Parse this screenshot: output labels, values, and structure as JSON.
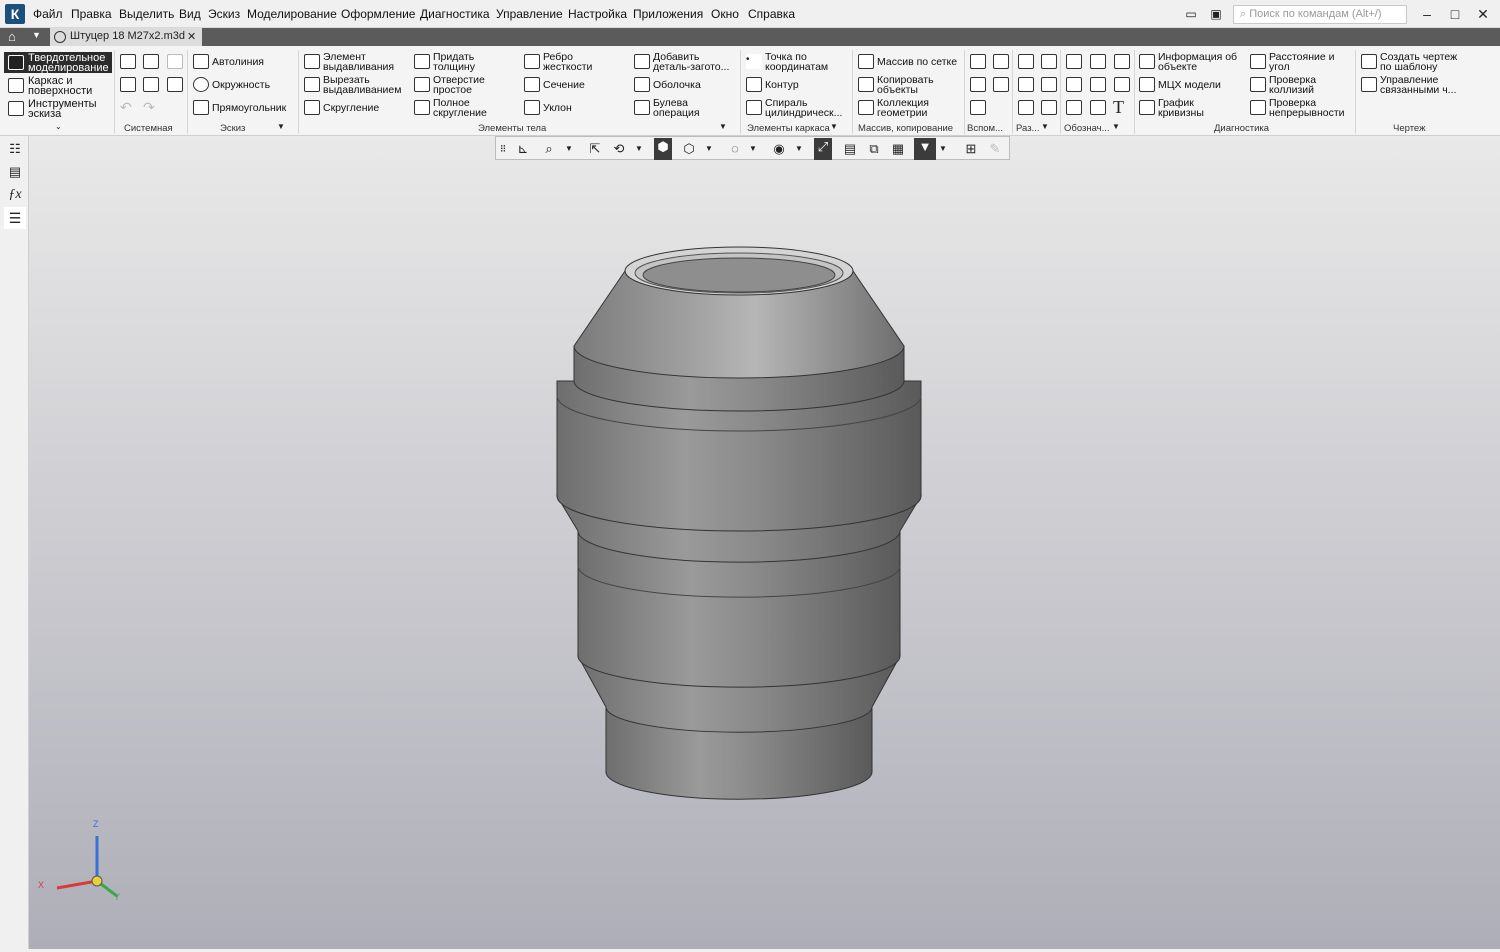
{
  "app": {
    "logo": "К",
    "icon": "kompas-logo-icon"
  },
  "menu": [
    "Файл",
    "Правка",
    "Выделить",
    "Вид",
    "Эскиз",
    "Моделирование",
    "Оформление",
    "Диагностика",
    "Управление",
    "Настройка",
    "Приложения",
    "Окно",
    "Справка"
  ],
  "search": {
    "placeholder": "Поиск по командам (Alt+/)"
  },
  "document_tab": {
    "title": "Штуцер 18 M27x2.m3d",
    "close": "✕"
  },
  "modes": [
    {
      "l1": "Твердотельное",
      "l2": "моделирование",
      "active": true
    },
    {
      "l1": "Каркас и",
      "l2": "поверхности",
      "active": false
    },
    {
      "l1": "Инструменты",
      "l2": "эскиза",
      "active": false
    }
  ],
  "ribbon": {
    "sketch": [
      "Автолиния",
      "Окружность",
      "Прямоугольник"
    ],
    "body": [
      {
        "l1": "Элемент",
        "l2": "выдавливания"
      },
      {
        "l1": "Вырезать",
        "l2": "выдавливанием"
      },
      {
        "l1": "Скругление",
        "l2": ""
      },
      {
        "l1": "Придать",
        "l2": "толщину"
      },
      {
        "l1": "Отверстие",
        "l2": "простое"
      },
      {
        "l1": "Полное",
        "l2": "скругление"
      },
      {
        "l1": "Ребро",
        "l2": "жесткости"
      },
      {
        "l1": "Сечение",
        "l2": ""
      },
      {
        "l1": "Уклон",
        "l2": ""
      },
      {
        "l1": "Добавить",
        "l2": "деталь-загото..."
      },
      {
        "l1": "Оболочка",
        "l2": ""
      },
      {
        "l1": "Булева",
        "l2": "операция"
      }
    ],
    "frame": [
      {
        "l1": "Точка по",
        "l2": "координатам"
      },
      {
        "l1": "Контур",
        "l2": ""
      },
      {
        "l1": "Спираль",
        "l2": "цилиндрическ..."
      }
    ],
    "array": [
      {
        "l1": "Массив по сетке",
        "l2": ""
      },
      {
        "l1": "Копировать",
        "l2": "объекты"
      },
      {
        "l1": "Коллекция",
        "l2": "геометрии"
      }
    ],
    "diag": [
      {
        "l1": "Информация об",
        "l2": "объекте"
      },
      {
        "l1": "МЦХ модели",
        "l2": ""
      },
      {
        "l1": "График",
        "l2": "кривизны"
      },
      {
        "l1": "Расстояние и",
        "l2": "угол"
      },
      {
        "l1": "Проверка",
        "l2": "коллизий"
      },
      {
        "l1": "Проверка",
        "l2": "непрерывности"
      }
    ],
    "drawing": [
      {
        "l1": "Создать чертеж",
        "l2": "по шаблону"
      },
      {
        "l1": "Управление",
        "l2": "связанными ч..."
      }
    ]
  },
  "group_labels": [
    "Системная",
    "Эскиз",
    "Элементы тела",
    "Элементы каркаса",
    "Массив, копирование",
    "Вспом...",
    "Раз...",
    "Обознач...",
    "Диагностика",
    "Чертеж"
  ],
  "axes": {
    "x": "X",
    "y": "Y",
    "z": "Z"
  },
  "colors": {
    "accent": "#1d4f7c",
    "part": "#8c8c8c",
    "viewport_top": "#e9e9e9",
    "viewport_bottom": "#aeaeb8"
  }
}
